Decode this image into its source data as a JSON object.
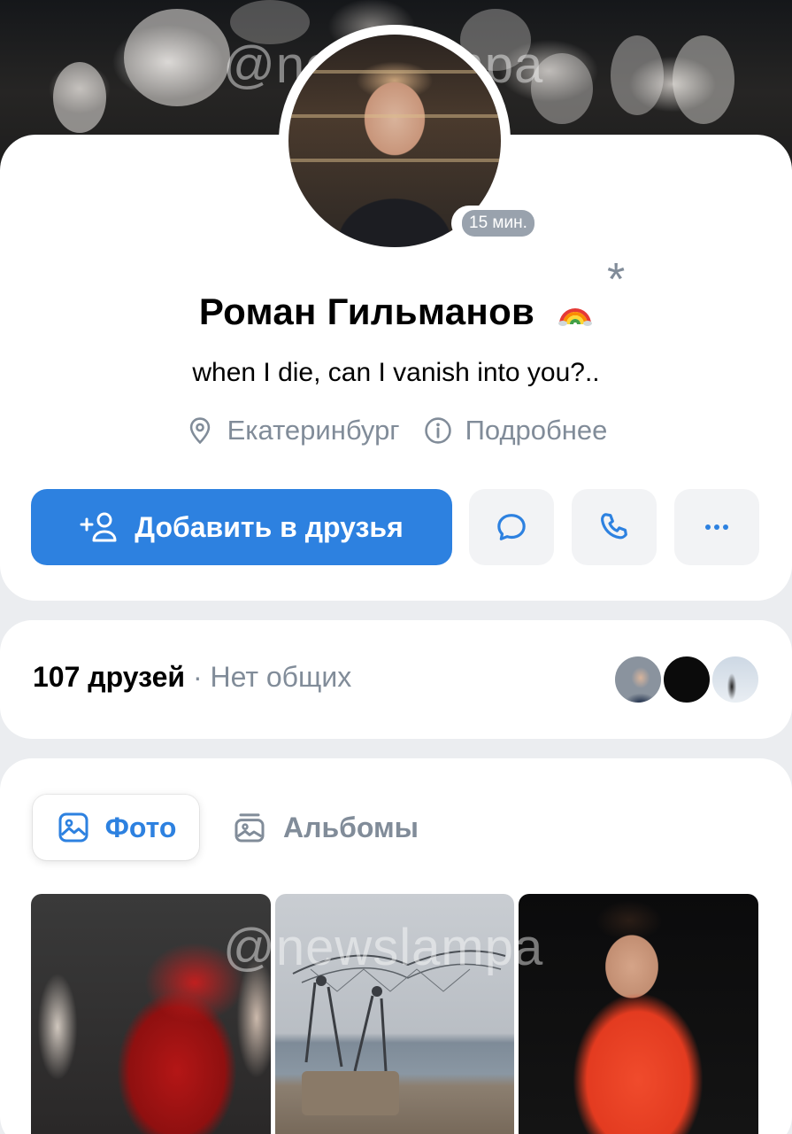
{
  "watermark": "@newslampa",
  "profile": {
    "last_seen": "15 мин.",
    "name": "Роман Гильманов",
    "status": "when I die, can I vanish into you?..",
    "city": "Екатеринбург",
    "details": "Подробнее"
  },
  "actions": {
    "add_friend": "Добавить в друзья"
  },
  "friends": {
    "count": "107 друзей",
    "mutual": " · Нет общих"
  },
  "photos": {
    "tabs": [
      {
        "label": "Фото",
        "active": true
      },
      {
        "label": "Альбомы",
        "active": false
      }
    ]
  },
  "colors": {
    "accent": "#2d81e0",
    "secondary_text": "#818c99",
    "background": "#ebedf0"
  }
}
